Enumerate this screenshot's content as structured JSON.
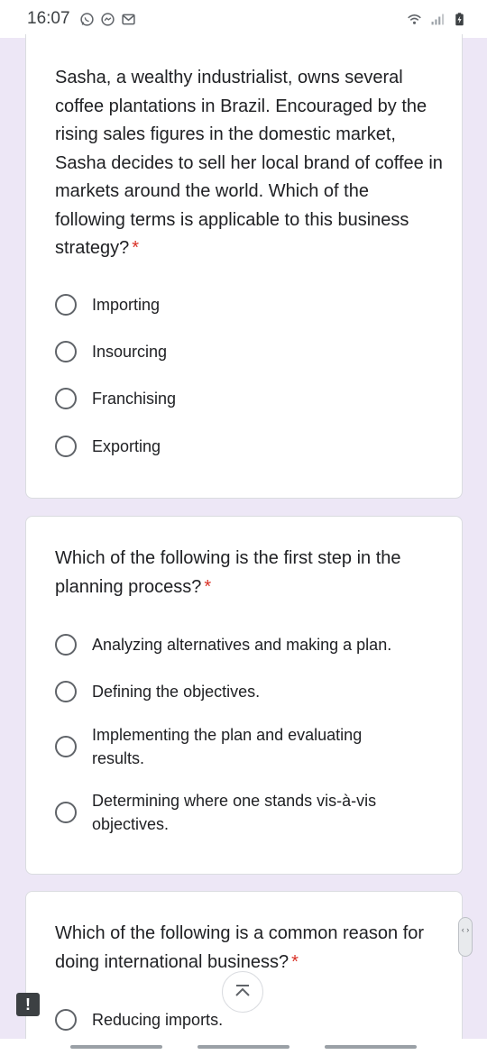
{
  "status_bar": {
    "time": "16:07",
    "left_icons": [
      "whatsapp-icon",
      "messenger-icon",
      "gmail-icon"
    ],
    "right_icons": [
      "wifi-icon",
      "signal-icon",
      "battery-charging-icon"
    ]
  },
  "questions": [
    {
      "text": "Sasha, a wealthy industrialist, owns several coffee plantations in Brazil. Encouraged by the rising sales figures in the domestic market, Sasha decides to sell her local brand of coffee in markets around the world. Which of the following terms is applicable to this business strategy?",
      "required_mark": "*",
      "options": [
        "Importing",
        "Insourcing",
        "Franchising",
        "Exporting"
      ]
    },
    {
      "text": "Which of the following is the first step in the planning process?",
      "required_mark": "*",
      "options": [
        "Analyzing alternatives and making a plan.",
        "Defining the objectives.",
        "Implementing the plan and evaluating results.",
        "Determining where one stands vis-à-vis objectives."
      ]
    },
    {
      "text": "Which of the following is a common reason for doing international business?",
      "required_mark": "*",
      "options": [
        "Reducing imports."
      ]
    }
  ],
  "overlays": {
    "alert_glyph": "!",
    "scroll_glyph": "‹ ›"
  },
  "colors": {
    "background": "#ede7f6",
    "required": "#d93025",
    "radio_border": "#5f6368"
  }
}
